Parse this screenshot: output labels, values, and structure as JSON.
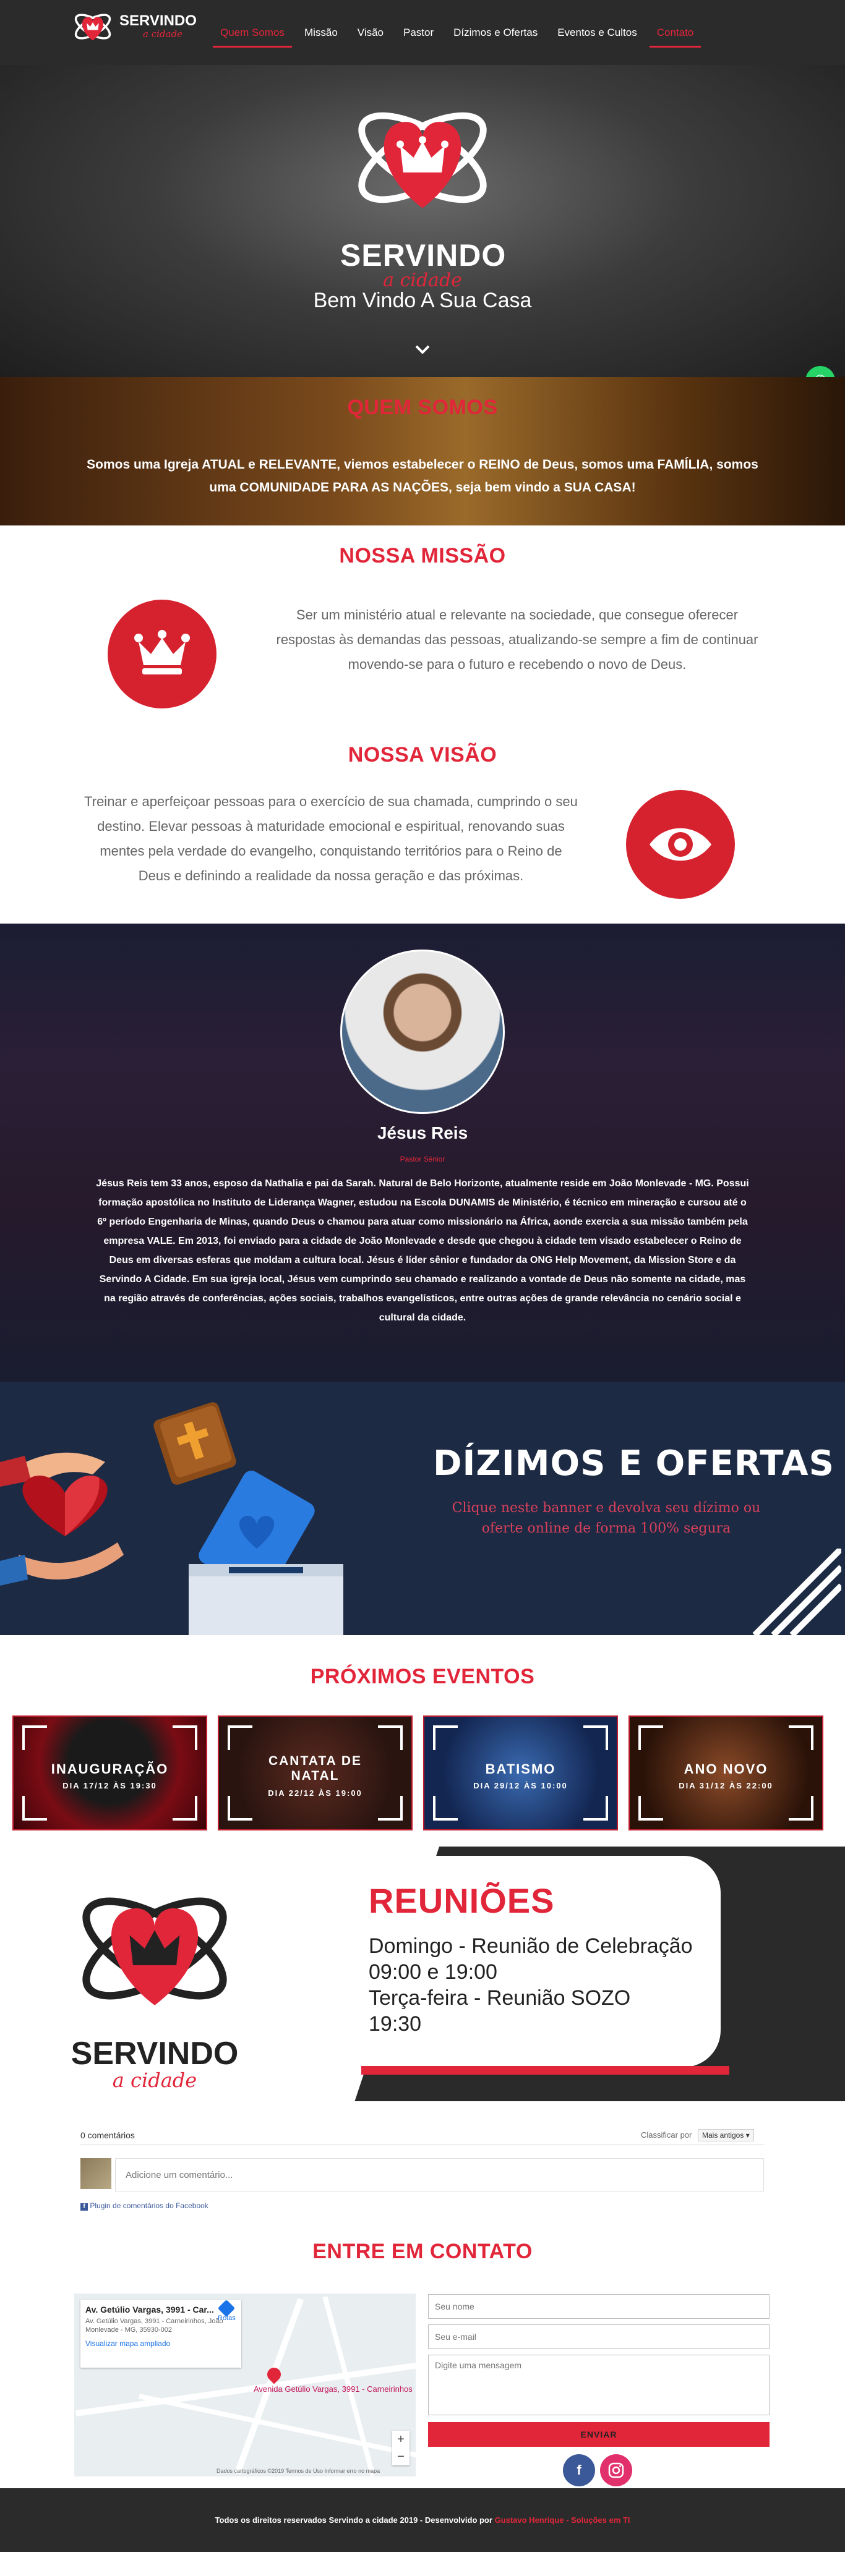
{
  "header": {
    "brand": "SERVINDO",
    "brand_sub": "a cidade",
    "nav": [
      {
        "label": "Quem Somos"
      },
      {
        "label": "Missão"
      },
      {
        "label": "Visão"
      },
      {
        "label": "Pastor"
      },
      {
        "label": "Dízimos e Ofertas"
      },
      {
        "label": "Eventos e Cultos"
      },
      {
        "label": "Contato"
      }
    ]
  },
  "hero": {
    "brand": "SERVINDO",
    "brand_sub": "a cidade",
    "welcome": "Bem Vindo A Sua Casa"
  },
  "quem_somos": {
    "title": "QUEM SOMOS",
    "text": "Somos uma Igreja ATUAL e RELEVANTE, viemos estabelecer o REINO de Deus, somos uma FAMÍLIA, somos uma COMUNIDADE PARA AS NAÇÕES, seja bem vindo a SUA CASA!"
  },
  "missao": {
    "title": "NOSSA MISSÃO",
    "text": "Ser um ministério atual e relevante na sociedade, que consegue oferecer respostas às demandas das pessoas, atualizando-se sempre a fim de continuar movendo-se para o futuro e recebendo o novo de Deus."
  },
  "visao": {
    "title": "NOSSA VISÃO",
    "text": "Treinar e aperfeiçoar pessoas para o exercício de sua chamada, cumprindo o seu destino. Elevar pessoas à maturidade emocional e espiritual, renovando suas mentes pela verdade do evangelho, conquistando territórios para o Reino de Deus e definindo a realidade da nossa geração e das próximas."
  },
  "pastor": {
    "name": "Jésus Reis",
    "role": "Pastor Sênior",
    "bio": "Jésus Reis tem 33 anos, esposo da Nathalia e pai da Sarah. Natural de Belo Horizonte, atualmente reside em João Monlevade - MG. Possui formação apostólica no Instituto de Liderança Wagner, estudou na Escola DUNAMIS de Ministério, é técnico em mineração e cursou até o 6º período Engenharia de Minas, quando Deus o chamou para atuar como missionário na África, aonde exercia a sua missão também pela empresa VALE. Em 2013, foi enviado para a cidade de João Monlevade e desde que chegou à cidade tem visado estabelecer o Reino de Deus em diversas esferas que moldam a cultura local. Jésus é líder sênior e fundador da ONG Help Movement, da Mission Store e da Servindo A Cidade. Em sua igreja local, Jésus vem cumprindo seu chamado e realizando a vontade de Deus não somente na cidade, mas na região através de conferências, ações sociais, trabalhos evangelísticos, entre outras ações de grande relevância no cenário social e cultural da cidade."
  },
  "dizimos": {
    "title": "DÍZIMOS E OFERTAS",
    "subtitle": "Clique neste banner e devolva seu dízimo ou oferte online de forma 100% segura"
  },
  "eventos": {
    "title": "PRÓXIMOS EVENTOS",
    "items": [
      {
        "title": "INAUGURAÇÃO",
        "date": "DIA 17/12 ÀS 19:30",
        "bg": "#5a0a10"
      },
      {
        "title": "CANTATA DE NATAL",
        "date": "DIA 22/12 ÀS 19:00",
        "bg": "#3a1a18"
      },
      {
        "title": "BATISMO",
        "date": "DIA 29/12 ÀS 10:00",
        "bg": "#1a2d5a"
      },
      {
        "title": "ANO NOVO",
        "date": "DIA 31/12 ÀS 22:00",
        "bg": "#4a2018"
      }
    ]
  },
  "reunioes": {
    "brand": "SERVINDO",
    "brand_sub": "a cidade",
    "title": "REUNIÕES",
    "lines": [
      "Domingo - Reunião de Celebração",
      "09:00 e 19:00",
      "Terça-feira - Reunião SOZO",
      "19:30"
    ]
  },
  "comments": {
    "count": "0 comentários",
    "sort_label": "Classificar por",
    "sort_value": "Mais antigos",
    "placeholder": "Adicione um comentário...",
    "plugin": "Plugin de comentários do Facebook"
  },
  "contato": {
    "title": "ENTRE EM CONTATO",
    "map": {
      "title": "Av. Getúlio Vargas, 3991 - Car...",
      "address": "Av. Getúlio Vargas, 3991 - Carneirinhos, João Monlevade - MG, 35930-002",
      "link": "Visualizar mapa ampliado",
      "routes": "Rotas",
      "pin_label": "Avenida Getúlio Vargas, 3991 - Carneirinhos",
      "footer": "Dados cartográficos ©2019   Termos de Uso   Informar erro no mapa",
      "zoom_in": "+",
      "zoom_out": "−"
    },
    "name_placeholder": "Seu nome",
    "email_placeholder": "Seu e-mail",
    "message_placeholder": "Digite uma mensagem",
    "send": "ENVIAR"
  },
  "footer": {
    "text": "Todos os direitos reservados Servindo a cidade 2019 - Desenvolvido por",
    "credit": "Gustavo Henrique - Soluções em TI"
  },
  "colors": {
    "accent": "#e2263a",
    "dark": "#2b2b2b",
    "navy": "#1d2a44",
    "whatsapp": "#25d366",
    "facebook": "#3b5998",
    "instagram": "#e1306c"
  }
}
